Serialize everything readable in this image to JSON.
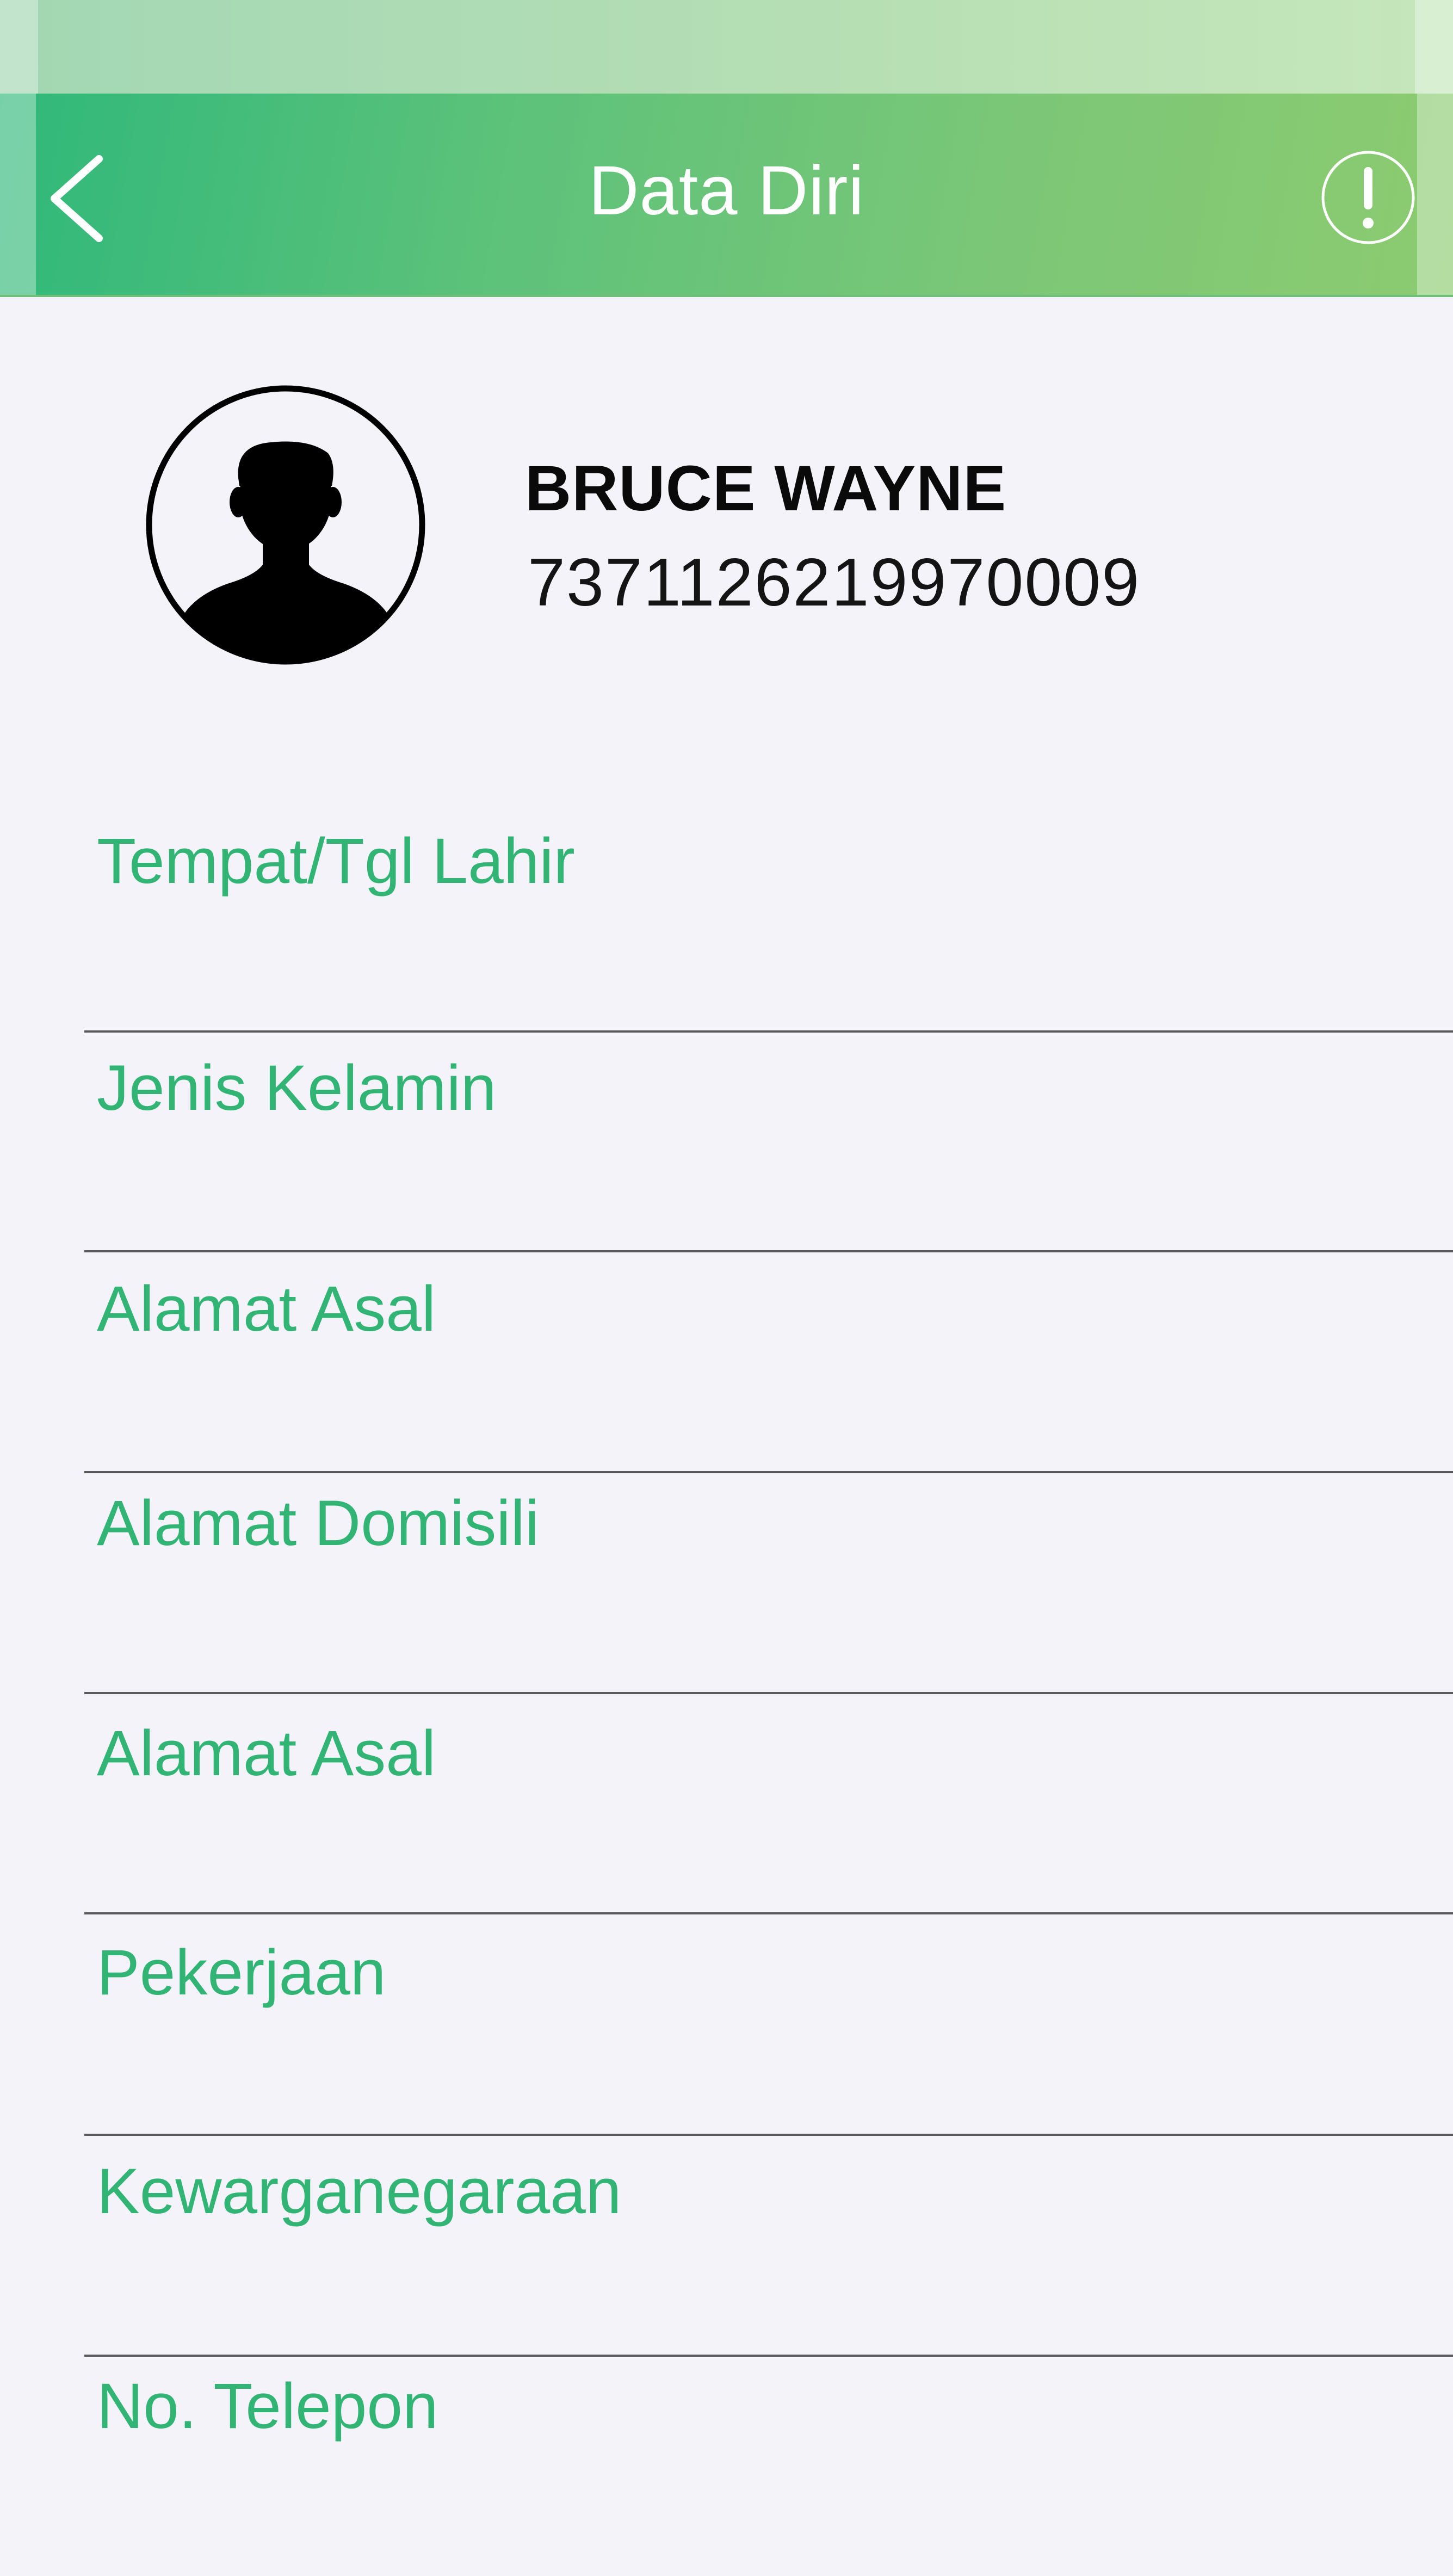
{
  "header": {
    "title": "Data Diri",
    "back_icon": "chevron-left-icon",
    "info_icon": "exclamation-circle-icon",
    "gradient_start": "#2FB87A",
    "gradient_end": "#8CCB70"
  },
  "profile": {
    "name": "BRUCE WAYNE",
    "id_number": "7371126219970009",
    "avatar_icon": "person-silhouette-icon"
  },
  "fields": [
    {
      "label": "Tempat/Tgl Lahir"
    },
    {
      "label": "Jenis Kelamin"
    },
    {
      "label": "Alamat Asal"
    },
    {
      "label": "Alamat Domisili"
    },
    {
      "label": "Alamat Asal"
    },
    {
      "label": "Pekerjaan"
    },
    {
      "label": "Kewarganegaraan"
    },
    {
      "label": "No. Telepon"
    }
  ],
  "colors": {
    "accent": "#32B475",
    "background": "#F3F3F9",
    "divider": "#5A5A5A"
  }
}
